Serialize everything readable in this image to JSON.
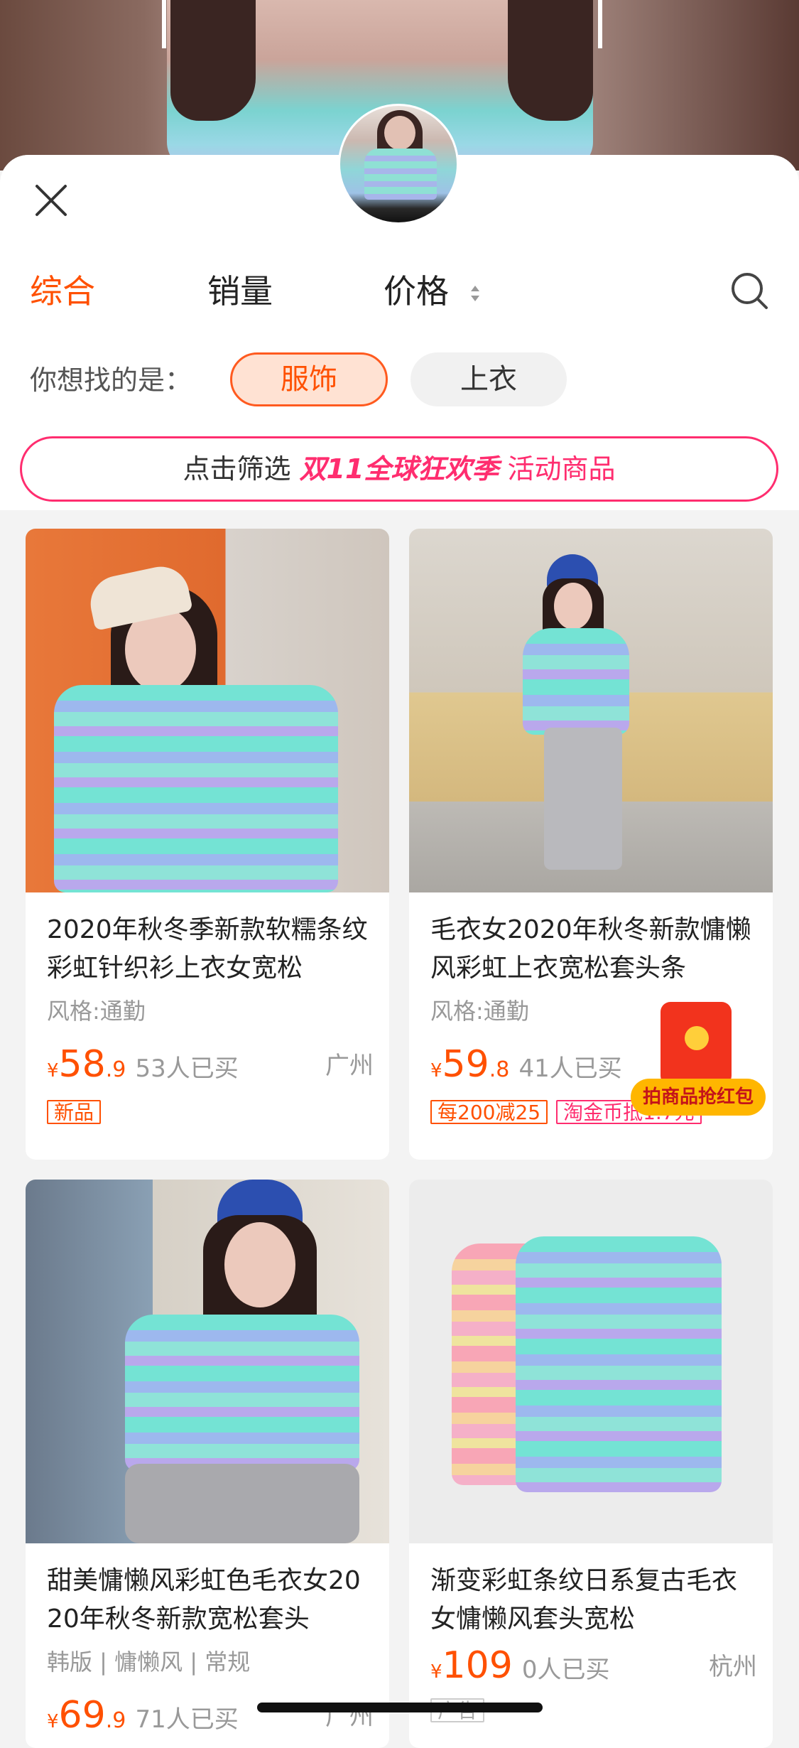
{
  "header": {
    "close_icon": "close-icon",
    "tabs": [
      {
        "label": "综合",
        "active": true
      },
      {
        "label": "销量",
        "active": false
      },
      {
        "label": "价格",
        "active": false
      }
    ],
    "search_icon": "search-icon"
  },
  "suggest": {
    "label": "你想找的是：",
    "chips": [
      "服饰",
      "上衣"
    ]
  },
  "banner": {
    "prefix": "点击筛选",
    "highlight": "双11全球狂欢季",
    "suffix": "活动商品"
  },
  "products": [
    {
      "title": "2020年秋冬季新款软糯条纹彩虹针织衫上衣女宽松",
      "style": "风格:通勤",
      "price_symbol": "¥",
      "price_int": "58",
      "price_dec": ".9",
      "sold": "53人已买",
      "city": "广州",
      "tags": [
        "新品"
      ]
    },
    {
      "title": "毛衣女2020年秋冬新款慵懒风彩虹上衣宽松套头条",
      "style": "风格:通勤",
      "price_symbol": "¥",
      "price_int": "59",
      "price_dec": ".8",
      "sold": "41人已买",
      "city": "",
      "tags": [
        "每200减25",
        "淘金币抵1.7元"
      ]
    },
    {
      "title": "甜美慵懒风彩虹色毛衣女2020年秋冬新款宽松套头",
      "style": "韩版 | 慵懒风 | 常规",
      "price_symbol": "¥",
      "price_int": "69",
      "price_dec": ".9",
      "sold": "71人已买",
      "city": "广州",
      "tags": []
    },
    {
      "title": "渐变彩虹条纹日系复古毛衣女慵懒风套头宽松",
      "style": "",
      "price_symbol": "¥",
      "price_int": "109",
      "price_dec": "",
      "sold": "0人已买",
      "city": "杭州",
      "tags": [
        "广告"
      ]
    }
  ],
  "red_packet": {
    "label": "拍商品抢红包",
    "icon": "red-packet-icon"
  },
  "colors": {
    "accent": "#ff5000",
    "promo": "#ff2d6f"
  }
}
